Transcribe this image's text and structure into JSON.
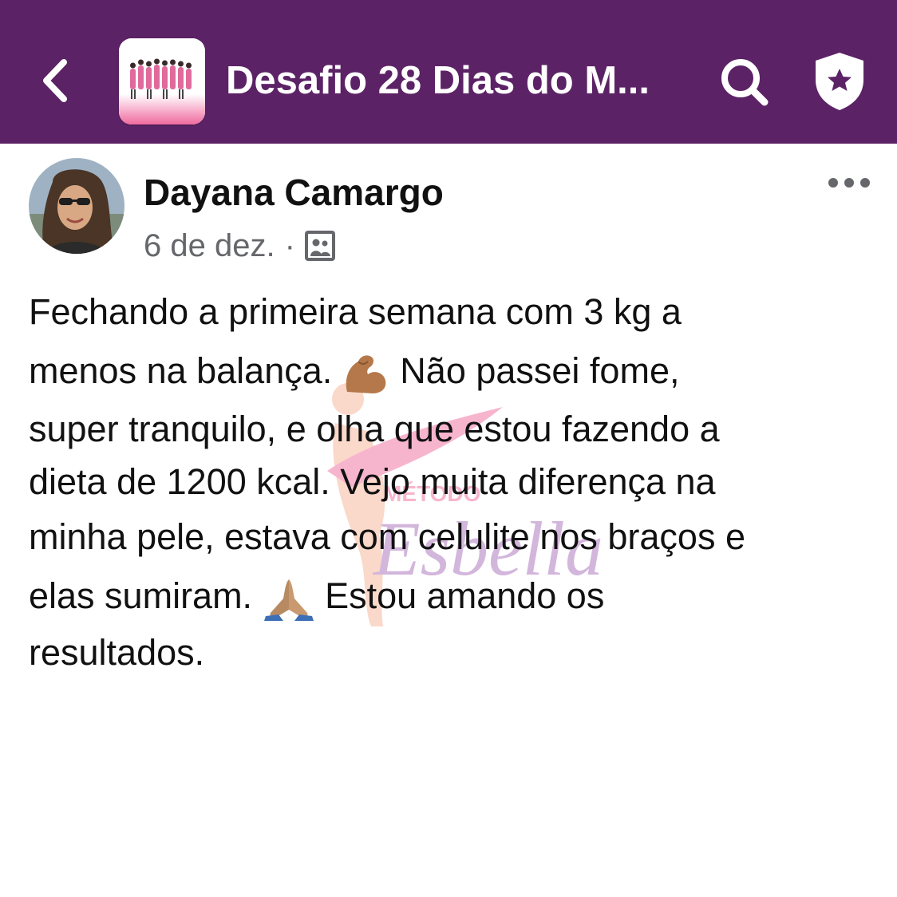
{
  "header": {
    "group_title": "Desafio 28 Dias do M...",
    "background_color": "#5c2266",
    "back_icon": "chevron-left-icon",
    "search_icon": "search-icon",
    "shield_icon": "shield-star-icon"
  },
  "post": {
    "author_name": "Dayana Camargo",
    "date": "6 de dez.",
    "separator": "·",
    "audience_icon": "group-audience-icon",
    "more_icon": "more-dots-icon",
    "lines": [
      "Fechando a primeira semana com 3 kg a",
      "menos na balança.",
      "Não passei fome,",
      "super tranquilo, e olha que estou fazendo a",
      "dieta de 1200 kcal. Vejo muita diferença na",
      "minha pele, estava com celulite nos braços e",
      "elas sumiram.",
      "Estou amando os",
      "resultados."
    ],
    "emoji_1": "flexed-biceps-emoji",
    "emoji_2": "folded-hands-emoji"
  },
  "watermark": {
    "line1": "MÉTODO",
    "line2": "Esbella",
    "color_pink": "#f27aa6",
    "color_purple": "#b07cc0"
  }
}
